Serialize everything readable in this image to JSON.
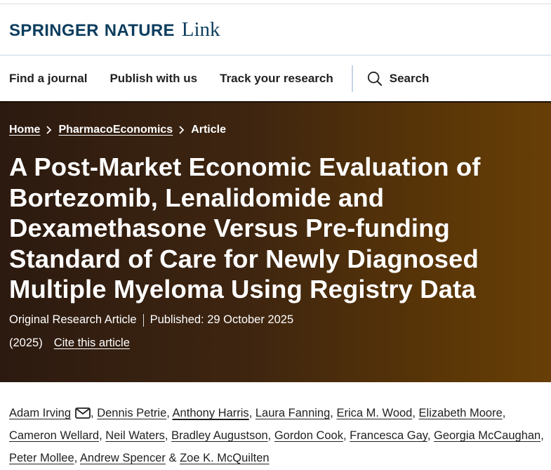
{
  "header": {
    "brand_part1": "SPRINGER",
    "brand_part2": "NATURE",
    "brand_link": "Link"
  },
  "nav": {
    "items": [
      {
        "label": "Find a journal"
      },
      {
        "label": "Publish with us"
      },
      {
        "label": "Track your research"
      }
    ],
    "search_label": "Search",
    "search_icon": "search-icon"
  },
  "breadcrumb": {
    "home": "Home",
    "journal": "PharmacoEconomics",
    "current": "Article"
  },
  "article": {
    "title": "A Post-Market Economic Evaluation of Bortezomib, Lenalidomide and Dexamethasone Versus Pre-funding Standard of Care for Newly Diagnosed Multiple Myeloma Using Registry Data",
    "type": "Original Research Article",
    "published": "Published: 29 October 2025",
    "year": "(2025)",
    "cite": "Cite this article"
  },
  "authors": {
    "list": [
      {
        "name": "Adam Irving",
        "sep": ""
      },
      {
        "name": "Dennis Petrie",
        "sep": ", "
      },
      {
        "name": "Anthony Harris",
        "sep": ", "
      },
      {
        "name": "Laura Fanning",
        "sep": ", "
      },
      {
        "name": "Erica M. Wood",
        "sep": ", "
      },
      {
        "name": "Elizabeth Moore",
        "sep": ", "
      },
      {
        "name": "Cameron Wellard",
        "sep": ", "
      },
      {
        "name": "Neil Waters",
        "sep": ", "
      },
      {
        "name": "Bradley Augustson",
        "sep": ", "
      },
      {
        "name": "Gordon Cook",
        "sep": ", "
      },
      {
        "name": "Francesca Gay",
        "sep": ", "
      },
      {
        "name": "Georgia McCaughan",
        "sep": ", "
      },
      {
        "name": "Peter Mollee",
        "sep": ", "
      },
      {
        "name": "Andrew Spencer",
        "sep": ", "
      },
      {
        "name": "Zoe K. McQuilten",
        "sep": " & "
      }
    ],
    "mail_icon": "email-icon"
  },
  "colors": {
    "brand": "#0c3d5e",
    "hero_dark": "#2c1a10",
    "hero_light": "#673e06",
    "divider": "#c5d5e4"
  }
}
